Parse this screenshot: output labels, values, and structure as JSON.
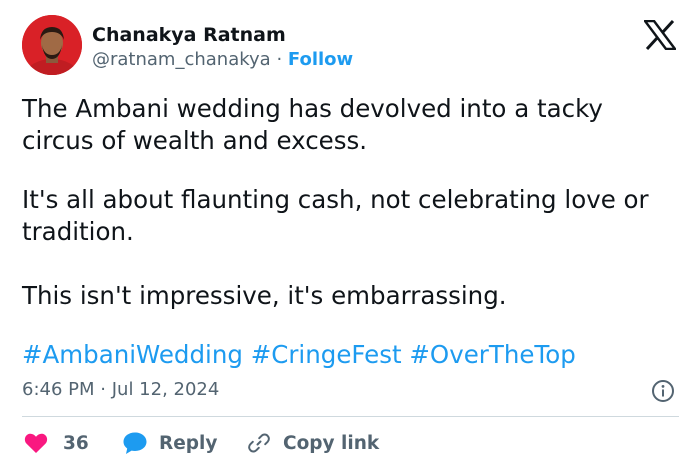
{
  "author": {
    "name": "Chanakya Ratnam",
    "handle": "@ratnam_chanakya",
    "separator": "·",
    "follow_label": "Follow"
  },
  "tweet": {
    "paragraphs": [
      "The Ambani wedding has devolved into a tacky circus of wealth and excess.",
      "It's all about flaunting cash, not celebrating love or tradition.",
      "This isn't impressive, it's embarrassing."
    ],
    "hashtags": [
      "#AmbaniWedding",
      "#CringeFest",
      "#OverTheTop"
    ],
    "time": "6:46 PM",
    "date": "Jul 12, 2024"
  },
  "actions": {
    "like_count": "36",
    "reply_label": "Reply",
    "copy_link_label": "Copy link"
  },
  "icons": {
    "brand": "x-logo-icon",
    "info": "info-icon",
    "like": "heart-icon",
    "reply": "speech-bubble-icon",
    "copy": "link-icon"
  },
  "colors": {
    "accent": "#1d9bf0",
    "heart": "#f91880",
    "text": "#0f1419",
    "muted": "#536471",
    "avatar_bg": "#d92127"
  }
}
